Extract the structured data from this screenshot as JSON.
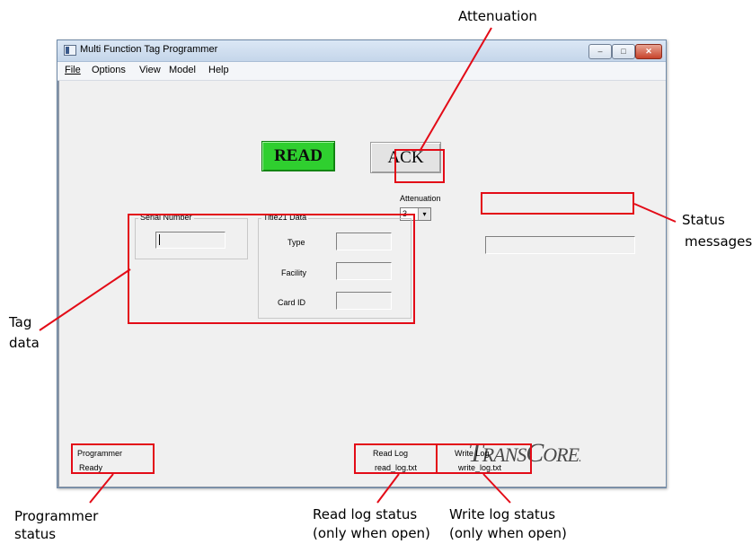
{
  "window": {
    "title": "Multi Function Tag Programmer",
    "controls": {
      "minimize": "–",
      "maximize": "□",
      "close": "✕"
    }
  },
  "menu": [
    "File",
    "Options",
    "View",
    "Model",
    "Help"
  ],
  "buttons": {
    "read": "READ",
    "ack": "ACK"
  },
  "attenuation": {
    "label": "Attenuation",
    "value": "3",
    "arrow": "▾"
  },
  "status_message": "",
  "serial_number": {
    "label": "Serial Number",
    "value": ""
  },
  "title21": {
    "label": "Title21 Data",
    "fields": [
      {
        "label": "Type",
        "value": ""
      },
      {
        "label": "Facility",
        "value": ""
      },
      {
        "label": "Card ID",
        "value": ""
      }
    ]
  },
  "logo": {
    "big1": "T",
    "small1": "RANS",
    "big2": "C",
    "small2": "ORE",
    "dot": "."
  },
  "statusbar": {
    "programmer": {
      "label": "Programmer",
      "value": "Ready"
    },
    "read_log": {
      "label": "Read Log",
      "value": "read_log.txt"
    },
    "write_log": {
      "label": "Write Log",
      "value": "write_log.txt"
    }
  },
  "annotations": {
    "attenuation": "Attenuation",
    "status_messages_1": "Status",
    "status_messages_2": "messages",
    "tag_data_1": "Tag",
    "tag_data_2": "data",
    "programmer_status_1": "Programmer",
    "programmer_status_2": "status",
    "read_log_status_1": "Read log status",
    "read_log_status_2": "(only when open)",
    "write_log_status_1": "Write log status",
    "write_log_status_2": "(only when open)"
  },
  "colors": {
    "annotation_red": "#e30b17",
    "read_button": "#2fcf2f"
  }
}
